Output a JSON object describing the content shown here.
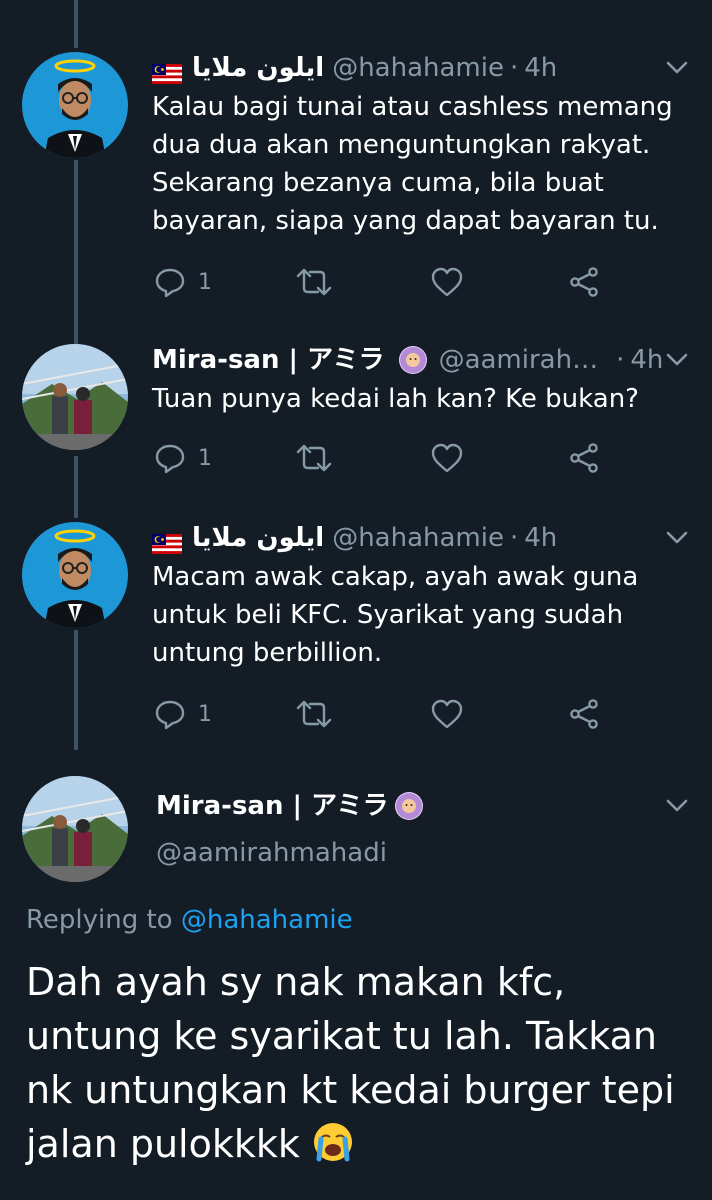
{
  "thread": {
    "tweets": [
      {
        "name": "ايلون ملايا",
        "handle": "@hahahamie",
        "dot": "·",
        "time": "4h",
        "text": "Kalau bagi tunai atau cashless memang dua dua akan menguntungkan rakyat. Sekarang bezanya cuma, bila buat bayaran, siapa yang dapat bayaran tu.",
        "reply_count": "1",
        "flag": "malaysia-flag-icon"
      },
      {
        "name": "Mira-san | アミラ",
        "handle": "@aamirah…",
        "dot": "·",
        "time": "4h",
        "text": "Tuan punya kedai lah kan? Ke bukan?",
        "reply_count": "1"
      },
      {
        "name": "ايلون ملايا",
        "handle": "@hahahamie",
        "dot": "·",
        "time": "4h",
        "text": "Macam awak cakap, ayah awak guna untuk beli KFC. Syarikat yang sudah untung berbillion.",
        "reply_count": "1",
        "flag": "malaysia-flag-icon"
      }
    ]
  },
  "focused": {
    "name": "Mira-san | アミラ",
    "handle": "@aamirahmahadi",
    "replying_prefix": "Replying to ",
    "replying_handle": "@hahahamie",
    "text": "Dah ayah sy nak makan kfc, untung ke syarikat tu lah. Takkan nk untungkan kt kedai burger tepi jalan pulokkkk"
  },
  "colors": {
    "background": "#141d26",
    "secondary_text": "#8899a6",
    "link": "#1da1f2",
    "thread_line": "#3d5466"
  }
}
